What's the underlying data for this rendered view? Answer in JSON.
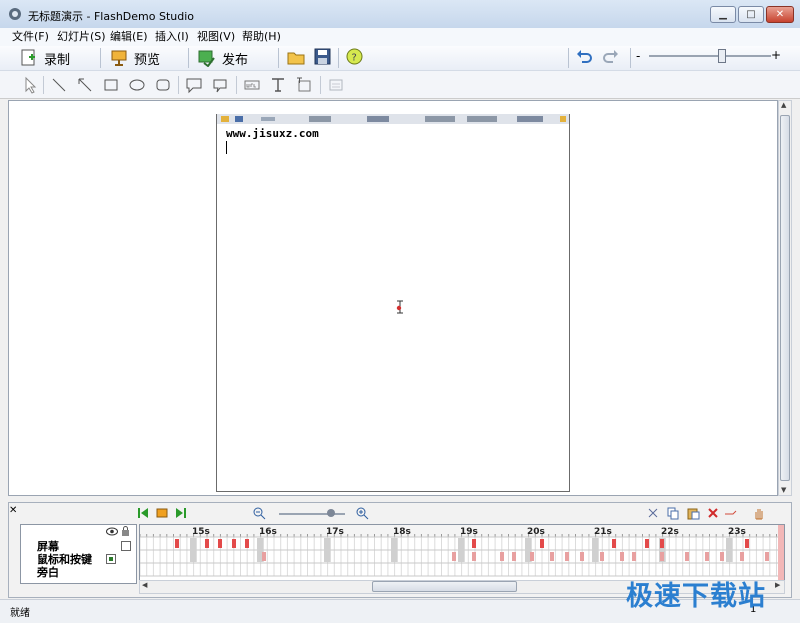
{
  "window": {
    "title": "无标题演示 - FlashDemo Studio"
  },
  "menu": [
    "文件(F)",
    "幻灯片(S)",
    "编辑(E)",
    "插入(I)",
    "视图(V)",
    "帮助(H)"
  ],
  "toolbar": {
    "record": "录制",
    "preview": "预览",
    "publish": "发布"
  },
  "canvas": {
    "text": "www.jisuxz.com"
  },
  "timeline": {
    "layers": [
      "屏幕",
      "鼠标和按键",
      "旁白"
    ],
    "ticks": [
      "15s",
      "16s",
      "17s",
      "18s",
      "19s",
      "20s",
      "21s",
      "22s",
      "23s"
    ]
  },
  "status": {
    "left": "就绪",
    "right": "1"
  },
  "watermark": "极速下载站",
  "colors": {
    "accent": "#2b7fd0",
    "marker": "#e34a4a"
  }
}
